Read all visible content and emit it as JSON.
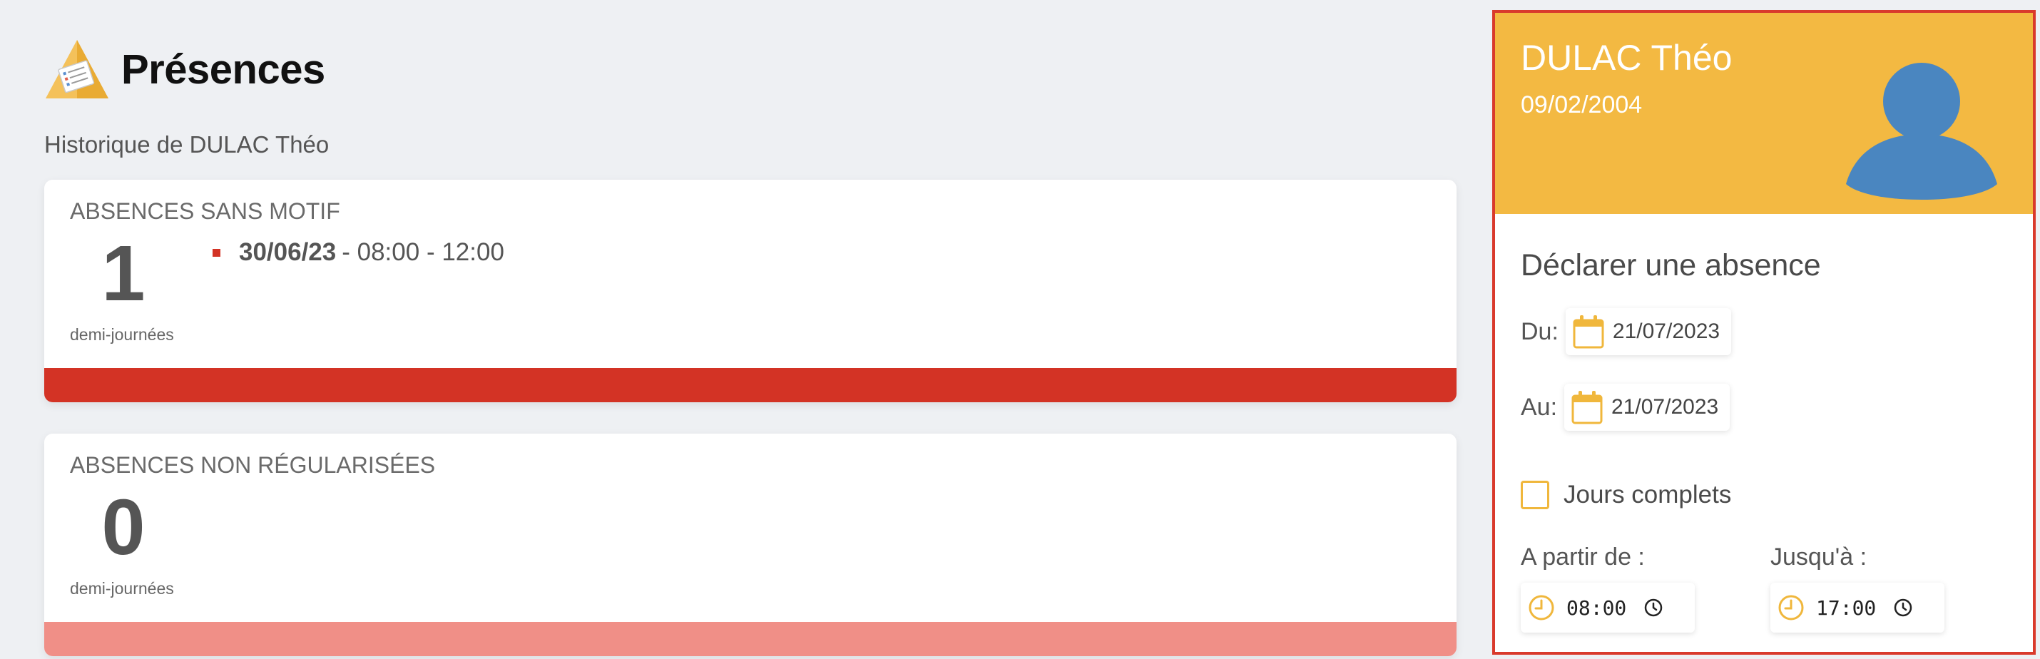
{
  "page": {
    "title": "Présences",
    "history_label": "Historique de DULAC Théo"
  },
  "cards": {
    "unjustified": {
      "title": "ABSENCES SANS MOTIF",
      "count": "1",
      "unit": "demi-journées",
      "bar_color": "#d33325",
      "bullet_color": "#d33325",
      "entries": [
        {
          "date": "30/06/23",
          "time": "- 08:00 - 12:00"
        }
      ]
    },
    "unregularized": {
      "title": "ABSENCES NON RÉGULARISÉES",
      "count": "0",
      "unit": "demi-journées",
      "bar_color": "#f08f87"
    }
  },
  "student": {
    "name": "DULAC Théo",
    "birthdate": "09/02/2004",
    "header_color": "#f3b942",
    "avatar_color": "#4a86c0"
  },
  "declare_form": {
    "title": "Déclarer une absence",
    "from_label": "Du:",
    "from_value": "21/07/2023",
    "to_label": "Au:",
    "to_value": "21/07/2023",
    "full_days_label": "Jours complets",
    "full_days_checked": false,
    "start_label": "A partir de :",
    "start_value": "08:00",
    "end_label": "Jusqu'à :",
    "end_value": "17:00",
    "accent_color": "#f0b73c"
  },
  "icons": {
    "logo": "attendance-sheet-triangle-icon",
    "calendar": "calendar-icon",
    "clock": "clock-icon"
  }
}
